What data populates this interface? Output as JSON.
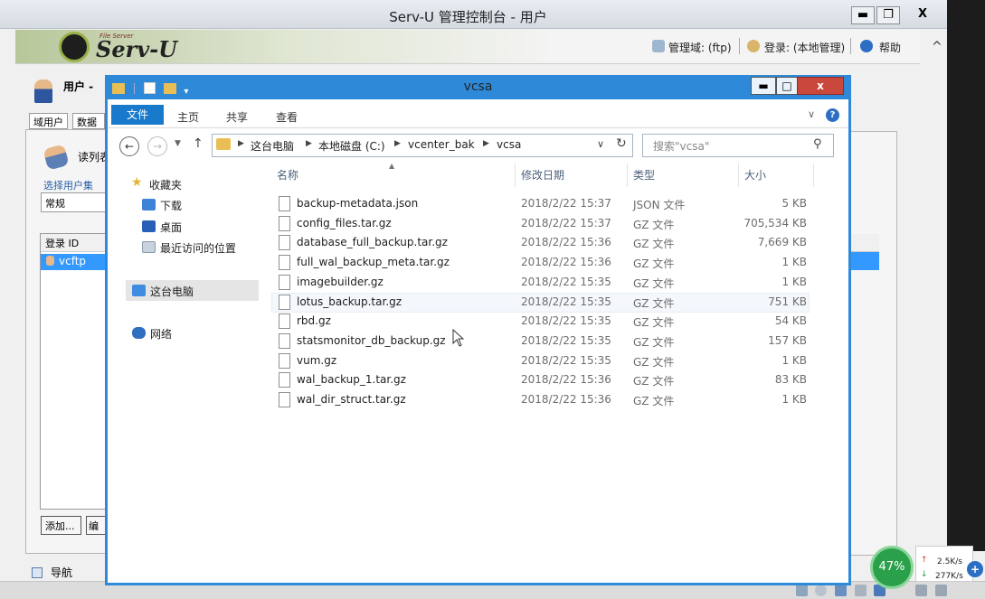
{
  "outer_window": {
    "title": "Serv-U 管理控制台 - 用户",
    "controls": {
      "minimize": "▬",
      "maximize": "❐",
      "close": "X"
    },
    "logo_small": "File Server",
    "logo": "Serv-U",
    "header_links": {
      "domain": "管理域: (ftp)",
      "login": "登录: (本地管理)",
      "help": "帮助"
    }
  },
  "servu": {
    "user_label": "用户 - ",
    "tabs": [
      "域用户",
      "数据库"
    ],
    "read_text": "读列表",
    "select_group": "选择用户集",
    "select_value": "常规",
    "list_header": "登录 ID",
    "list_row": "vcftp",
    "add_button": "添加...",
    "edit_button": "编",
    "nav_label": "导航"
  },
  "explorer": {
    "title": "vcsa",
    "ribbon_tabs": [
      "文件",
      "主页",
      "共享",
      "查看"
    ],
    "breadcrumb": [
      "这台电脑",
      "本地磁盘 (C:)",
      "vcenter_bak",
      "vcsa"
    ],
    "search_placeholder": "搜索\"vcsa\"",
    "nav_pane": {
      "favorites": "收藏夹",
      "downloads": "下载",
      "desktop": "桌面",
      "recent": "最近访问的位置",
      "this_pc": "这台电脑",
      "network": "网络"
    },
    "columns": {
      "name": "名称",
      "modified": "修改日期",
      "type": "类型",
      "size": "大小"
    },
    "files": [
      {
        "name": "backup-metadata.json",
        "modified": "2018/2/22 15:37",
        "type": "JSON 文件",
        "size": "5 KB"
      },
      {
        "name": "config_files.tar.gz",
        "modified": "2018/2/22 15:37",
        "type": "GZ 文件",
        "size": "705,534 KB"
      },
      {
        "name": "database_full_backup.tar.gz",
        "modified": "2018/2/22 15:36",
        "type": "GZ 文件",
        "size": "7,669 KB"
      },
      {
        "name": "full_wal_backup_meta.tar.gz",
        "modified": "2018/2/22 15:36",
        "type": "GZ 文件",
        "size": "1 KB"
      },
      {
        "name": "imagebuilder.gz",
        "modified": "2018/2/22 15:35",
        "type": "GZ 文件",
        "size": "1 KB"
      },
      {
        "name": "lotus_backup.tar.gz",
        "modified": "2018/2/22 15:35",
        "type": "GZ 文件",
        "size": "751 KB"
      },
      {
        "name": "rbd.gz",
        "modified": "2018/2/22 15:35",
        "type": "GZ 文件",
        "size": "54 KB"
      },
      {
        "name": "statsmonitor_db_backup.gz",
        "modified": "2018/2/22 15:35",
        "type": "GZ 文件",
        "size": "157 KB"
      },
      {
        "name": "vum.gz",
        "modified": "2018/2/22 15:35",
        "type": "GZ 文件",
        "size": "1 KB"
      },
      {
        "name": "wal_backup_1.tar.gz",
        "modified": "2018/2/22 15:36",
        "type": "GZ 文件",
        "size": "83 KB"
      },
      {
        "name": "wal_dir_struct.tar.gz",
        "modified": "2018/2/22 15:36",
        "type": "GZ 文件",
        "size": "1 KB"
      }
    ]
  },
  "speed_widget": {
    "percent": "47%",
    "up": "2.5K/s",
    "down": "277K/s"
  }
}
